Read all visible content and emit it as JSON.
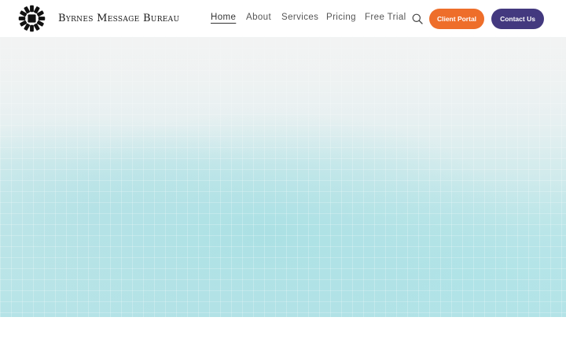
{
  "brand": {
    "name": "Byrnes Message Bureau",
    "logo_icon": "sunburst-logo-icon"
  },
  "nav": {
    "items": [
      {
        "label": "Home",
        "active": true
      },
      {
        "label": "About",
        "active": false
      },
      {
        "label": "Services",
        "active": false
      },
      {
        "label": "Pricing",
        "active": false
      },
      {
        "label": "Free Trial",
        "active": false
      }
    ],
    "search_icon": "search-icon"
  },
  "buttons": {
    "client_portal": {
      "label": "Client Portal",
      "color": "#ee6e2a"
    },
    "contact_us": {
      "label": "Contact Us",
      "color": "#43397f"
    }
  },
  "hero": {
    "colors": {
      "top": "#f1f3f3",
      "bottom": "#b5e3e7"
    }
  }
}
